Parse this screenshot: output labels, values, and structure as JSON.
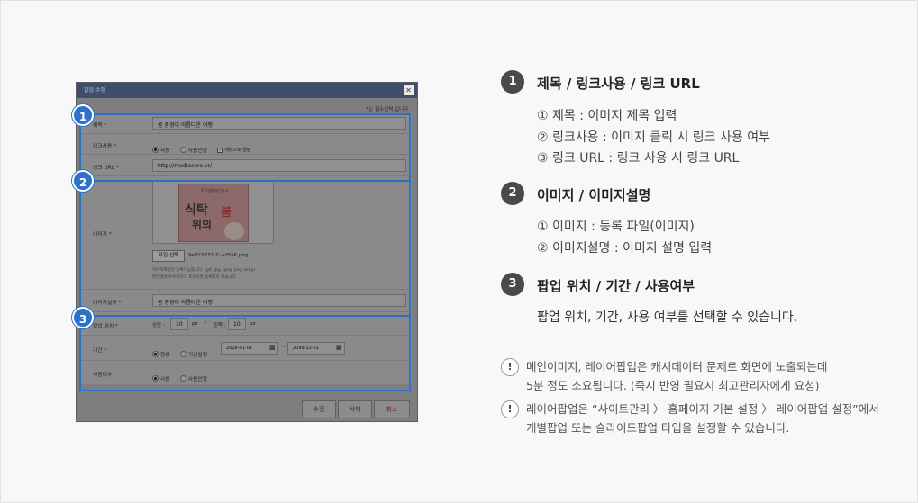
{
  "popup": {
    "title": "팝업 수정",
    "close_glyph": "✕",
    "required_note": "*는 필수입력 입니다.",
    "required_star": "*",
    "fields": {
      "title_label": "제목",
      "title_value": "봄 풍경이 아름다운 여행",
      "link_use_label": "링크사용",
      "link_use_options": [
        "사용",
        "사용안함"
      ],
      "link_newwin_label": "새창으로 열림",
      "link_url_label": "링크 URL",
      "link_url_value": "http://mediacore.kr/",
      "image_label": "이미지",
      "image_thumb_top": "직장생활 퇴근하고",
      "image_thumb_left": "식탁",
      "image_thumb_right": "봄",
      "image_thumb_line2": "위의",
      "file_button": "파일 선택",
      "file_name": "9e823332-7···cf556.png",
      "image_help1": "이미지파일만 등록가능합니다. (gif, jpg, jpeg, png, bmp)",
      "image_help2": "파일명에 특수문자가 포함되면 등록되지 않습니다.",
      "image_desc_label": "이미지설명",
      "image_desc_value": "봄 풍경이 아름다운 여행",
      "position_label": "팝업 위치",
      "pos_top_label": "상단 :",
      "pos_top_value": "10",
      "pos_left_label": "왼쪽 :",
      "pos_left_value": "10",
      "pos_unit": "px",
      "pos_sep": "/",
      "period_label": "기간",
      "period_options": [
        "항상",
        "기간설정"
      ],
      "period_start": "2016-01-01",
      "period_sep": "~",
      "period_end": "2099-12-31",
      "use_label": "사용여부",
      "use_options": [
        "사용",
        "사용안함"
      ]
    },
    "buttons": {
      "edit": "수정",
      "delete": "삭제",
      "cancel": "취소"
    }
  },
  "badges": [
    "1",
    "2",
    "3"
  ],
  "steps": [
    {
      "num": "1",
      "title": "제목 / 링크사용 / 링크 URL",
      "lines": [
        "① 제목 : 이미지 제목 입력",
        "② 링크사용 : 이미지 클릭 시 링크 사용 여부",
        "③ 링크 URL : 링크 사용 시 링크 URL"
      ]
    },
    {
      "num": "2",
      "title": "이미지 / 이미지설명",
      "lines": [
        "① 이미지 : 등록 파일(이미지)",
        "② 이미지설명 : 이미지 설명 입력"
      ]
    },
    {
      "num": "3",
      "title": "팝업 위치 / 기간 / 사용여부",
      "lines": [
        "팝업 위치, 기간, 사용 여부를 선택할 수 있습니다."
      ]
    }
  ],
  "notes": [
    {
      "icon": "!",
      "lines": [
        "메인이미지, 레이어팝업은 캐시데이터 문제로 화면에 노출되는데",
        "5분 정도 소요됩니다. (즉시 반영 필요시 최고관리자에게 요청)"
      ]
    },
    {
      "icon": "!",
      "lines": [
        "레이어팝업은 “사이트관리 〉 홈페이지 기본 설정 〉 레이어팝업 설정”에서",
        "개별팝업 또는 슬라이드팝업 타입을 설정할 수 있습니다."
      ]
    }
  ]
}
